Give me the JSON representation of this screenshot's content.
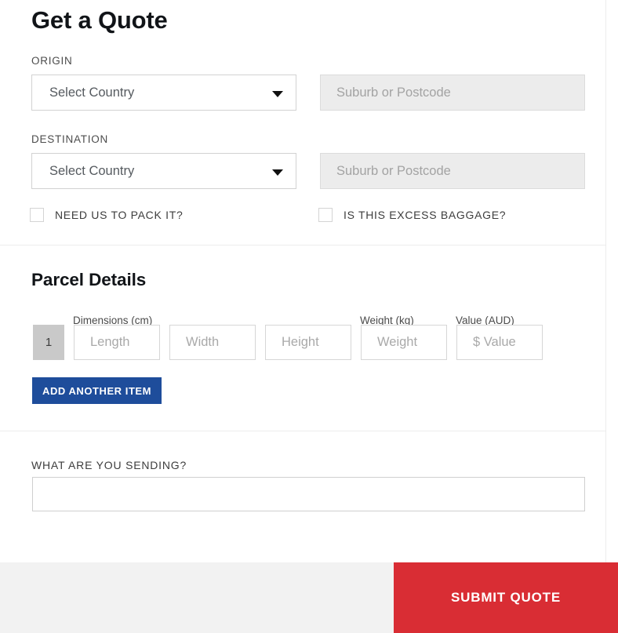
{
  "page": {
    "title": "Get a Quote"
  },
  "origin": {
    "label": "ORIGIN",
    "country_value": "Select Country",
    "suburb_placeholder": "Suburb or Postcode",
    "suburb_value": ""
  },
  "destination": {
    "label": "DESTINATION",
    "country_value": "Select Country",
    "suburb_placeholder": "Suburb or Postcode",
    "suburb_value": ""
  },
  "options": {
    "pack_label": "NEED US TO PACK IT?",
    "pack_checked": false,
    "excess_label": "IS THIS EXCESS BAGGAGE?",
    "excess_checked": false
  },
  "parcel": {
    "title": "Parcel Details",
    "dimensions_header": "Dimensions (cm)",
    "weight_header": "Weight (kg)",
    "value_header": "Value (AUD)",
    "row_number": "1",
    "length_placeholder": "Length",
    "length_value": "",
    "width_placeholder": "Width",
    "width_value": "",
    "height_placeholder": "Height",
    "height_value": "",
    "weight_placeholder": "Weight",
    "weight_value": "",
    "value_placeholder": "$ Value",
    "value_value": "",
    "add_item_label": "ADD ANOTHER ITEM"
  },
  "sending": {
    "label": "WHAT ARE YOU SENDING?",
    "value": "",
    "placeholder": ""
  },
  "footer": {
    "submit_label": "SUBMIT QUOTE"
  },
  "colors": {
    "accent_blue": "#1e4d9b",
    "accent_red": "#d92d34",
    "row_badge_gray": "#c9c9c9",
    "disabled_field": "#ececec",
    "footer_bg": "#f2f2f2"
  }
}
